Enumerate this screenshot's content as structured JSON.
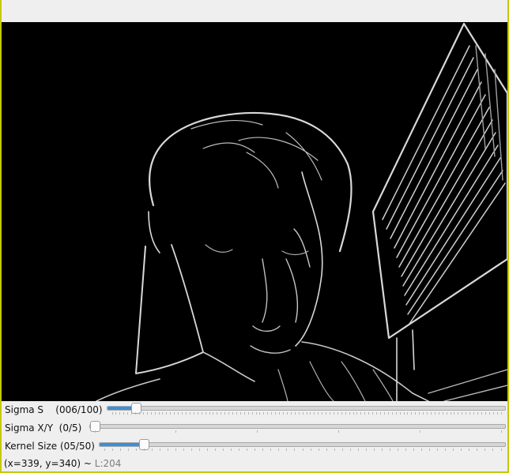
{
  "trackbars": [
    {
      "label": "Sigma S    (006/100)",
      "value": 6,
      "max": 100,
      "tick_count": 100
    },
    {
      "label": "Sigma X/Y  (0/5)",
      "value": 0,
      "max": 5,
      "tick_count": 5
    },
    {
      "label": "Kernel Size (05/50)",
      "value": 5,
      "max": 50,
      "tick_count": 50
    }
  ],
  "status": {
    "coords": "(x=339, y=340) ~ ",
    "lum": "L:204"
  },
  "colors": {
    "accent": "#3a8fd9",
    "image_background": "#000000",
    "edge_stroke": "#d8d8d8"
  },
  "image": {
    "description_icon": "edge-detected-webcam-frame"
  }
}
